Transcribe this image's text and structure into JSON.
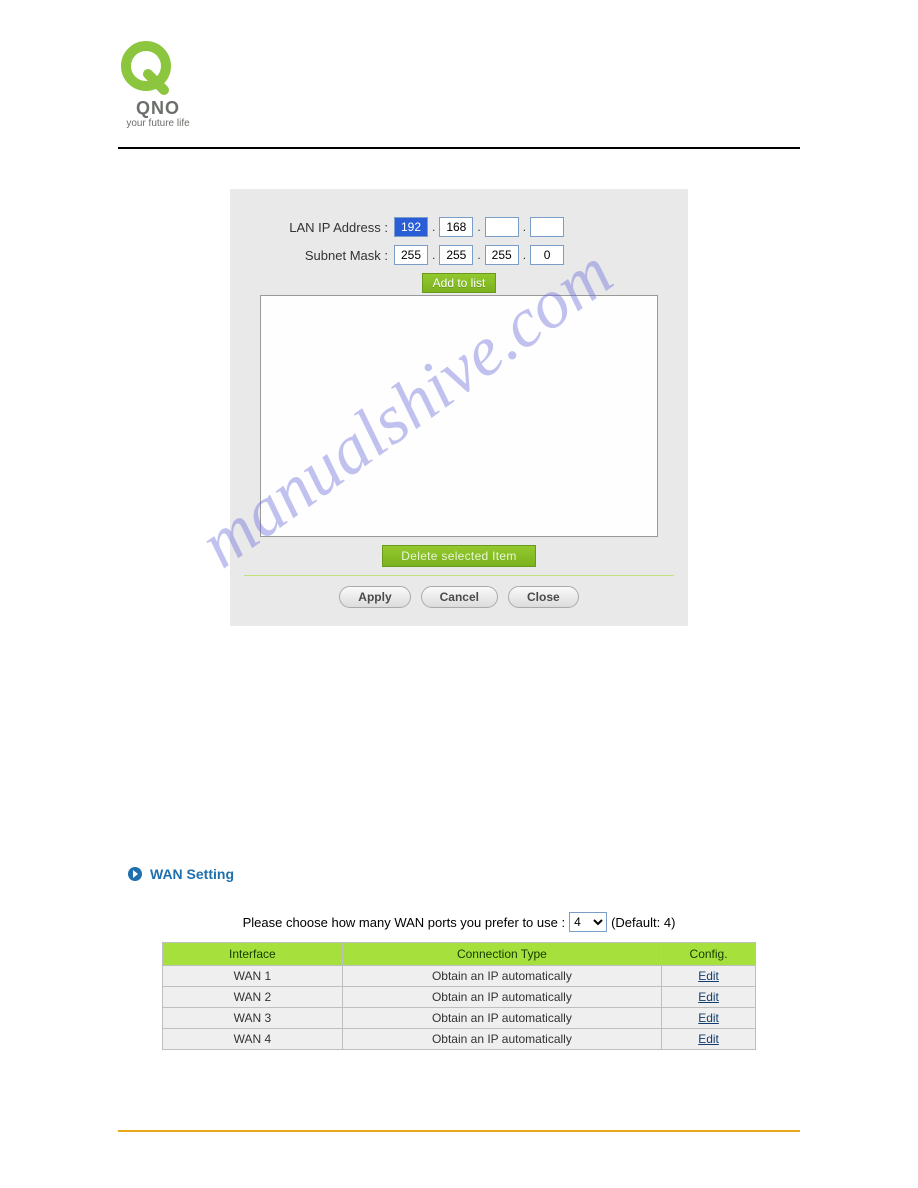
{
  "brand": {
    "name": "QNO",
    "tagline": "your future life"
  },
  "lan_form": {
    "ip_label": "LAN IP Address :",
    "mask_label": "Subnet Mask :",
    "ip": [
      "192",
      "168",
      "",
      ""
    ],
    "mask": [
      "255",
      "255",
      "255",
      "0"
    ],
    "add_btn": "Add to list",
    "delete_btn": "Delete selected Item",
    "apply_btn": "Apply",
    "cancel_btn": "Cancel",
    "close_btn": "Close"
  },
  "watermark": "manualshive.com",
  "wan_section": {
    "title": "WAN Setting",
    "choose_prefix": "Please choose how many WAN ports you prefer to use :",
    "choose_value": "4",
    "choose_default": "(Default: 4)",
    "headers": {
      "iface": "Interface",
      "conn": "Connection Type",
      "cfg": "Config."
    },
    "rows": [
      {
        "iface": "WAN 1",
        "conn": "Obtain an IP automatically",
        "cfg": "Edit"
      },
      {
        "iface": "WAN 2",
        "conn": "Obtain an IP automatically",
        "cfg": "Edit"
      },
      {
        "iface": "WAN 3",
        "conn": "Obtain an IP automatically",
        "cfg": "Edit"
      },
      {
        "iface": "WAN 4",
        "conn": "Obtain an IP automatically",
        "cfg": "Edit"
      }
    ]
  }
}
